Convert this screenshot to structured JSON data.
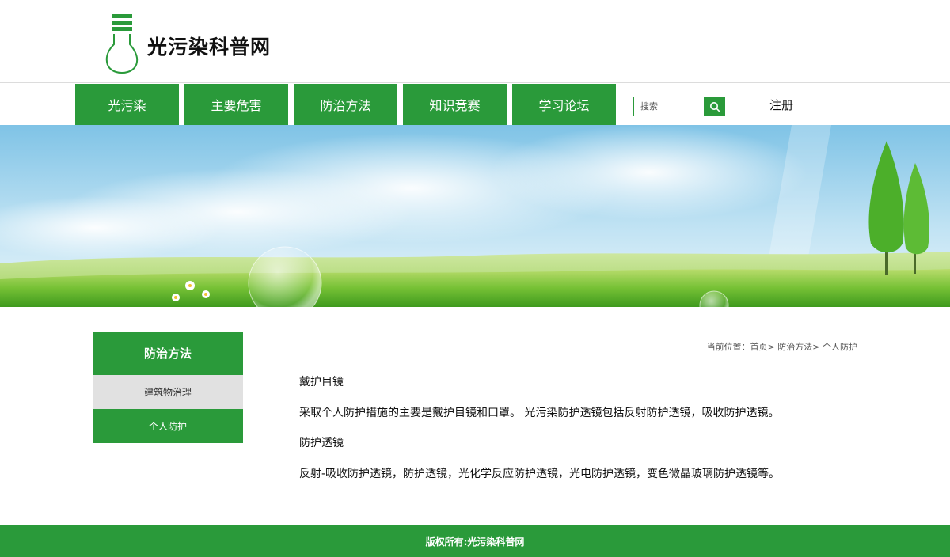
{
  "header": {
    "site_title": "光污染科普网",
    "logo_icon": "lightbulb-icon"
  },
  "nav": {
    "items": [
      {
        "label": "光污染"
      },
      {
        "label": "主要危害"
      },
      {
        "label": "防治方法"
      },
      {
        "label": "知识竞赛"
      },
      {
        "label": "学习论坛"
      }
    ],
    "search_placeholder": "搜索",
    "search_icon": "search-icon",
    "register_label": "注册"
  },
  "colors": {
    "brand_green": "#2a9a3a",
    "sidebar_grey": "#e1e1e1"
  },
  "sidebar": {
    "title": "防治方法",
    "items": [
      {
        "label": "建筑物治理"
      },
      {
        "label": "个人防护"
      }
    ]
  },
  "breadcrumb": {
    "prefix": "当前位置：",
    "home": "首页",
    "sep1": "> ",
    "section": "防治方法",
    "sep2": "> ",
    "current": "个人防护"
  },
  "content": {
    "heading1": "戴护目镜",
    "para1": "采取个人防护措施的主要是戴护目镜和口罩。 光污染防护透镜包括反射防护透镜，吸收防护透镜。",
    "heading2": "防护透镜",
    "para2": "反射-吸收防护透镜，防护透镜，光化学反应防护透镜，光电防护透镜，变色微晶玻璃防护透镜等。"
  },
  "footer": {
    "copyright": "版权所有:光污染科普网"
  }
}
